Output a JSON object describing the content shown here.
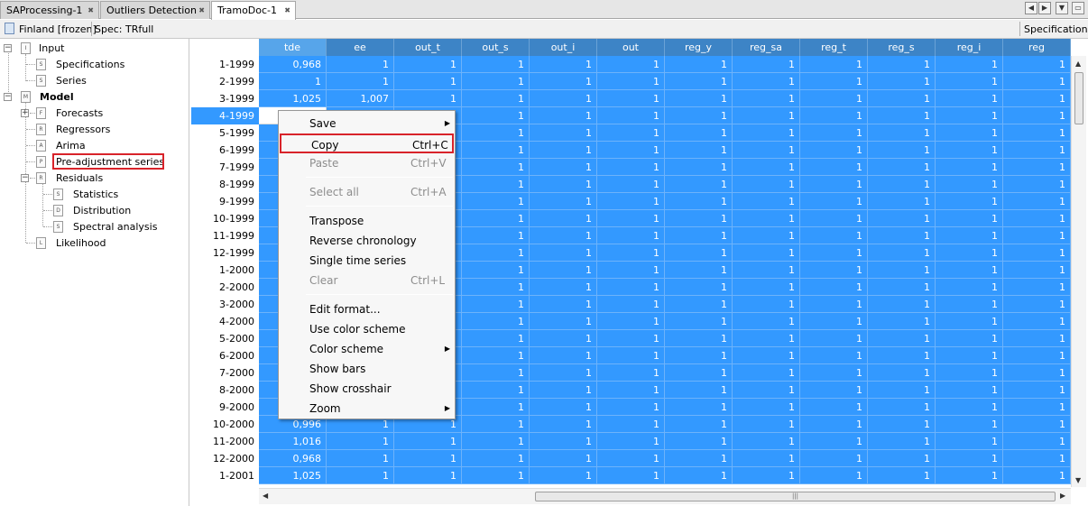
{
  "tabs": [
    {
      "label": "SAProcessing-1",
      "active": false
    },
    {
      "label": "Outliers Detection",
      "active": false
    },
    {
      "label": "TramoDoc-1",
      "active": true
    }
  ],
  "infobar": {
    "document": "Finland [frozen]",
    "spec": "Spec: TRfull",
    "right_label": "Specifications"
  },
  "tree": {
    "input": "Input",
    "specifications": "Specifications",
    "series": "Series",
    "model": "Model",
    "forecasts": "Forecasts",
    "regressors": "Regressors",
    "arima": "Arima",
    "preadjustment": "Pre-adjustment series",
    "residuals": "Residuals",
    "statistics": "Statistics",
    "distribution": "Distribution",
    "spectral": "Spectral analysis",
    "likelihood": "Likelihood"
  },
  "table": {
    "columns": [
      "tde",
      "ee",
      "out_t",
      "out_s",
      "out_i",
      "out",
      "reg_y",
      "reg_sa",
      "reg_t",
      "reg_s",
      "reg_i",
      "reg"
    ],
    "rows": [
      {
        "label": "1-1999",
        "tde": "0,968",
        "ee": "1"
      },
      {
        "label": "2-1999",
        "tde": "1",
        "ee": "1"
      },
      {
        "label": "3-1999",
        "tde": "1,025",
        "ee": "1,007"
      },
      {
        "label": "4-1999",
        "tde": "",
        "ee": ""
      },
      {
        "label": "5-1999",
        "tde": "",
        "ee": ""
      },
      {
        "label": "6-1999",
        "tde": "",
        "ee": ""
      },
      {
        "label": "7-1999",
        "tde": "",
        "ee": ""
      },
      {
        "label": "8-1999",
        "tde": "",
        "ee": ""
      },
      {
        "label": "9-1999",
        "tde": "",
        "ee": ""
      },
      {
        "label": "10-1999",
        "tde": "",
        "ee": ""
      },
      {
        "label": "11-1999",
        "tde": "",
        "ee": ""
      },
      {
        "label": "12-1999",
        "tde": "",
        "ee": ""
      },
      {
        "label": "1-2000",
        "tde": "",
        "ee": ""
      },
      {
        "label": "2-2000",
        "tde": "",
        "ee": ""
      },
      {
        "label": "3-2000",
        "tde": "",
        "ee": ""
      },
      {
        "label": "4-2000",
        "tde": "",
        "ee": ""
      },
      {
        "label": "5-2000",
        "tde": "",
        "ee": ""
      },
      {
        "label": "6-2000",
        "tde": "",
        "ee": ""
      },
      {
        "label": "7-2000",
        "tde": "",
        "ee": ""
      },
      {
        "label": "8-2000",
        "tde": "",
        "ee": ""
      },
      {
        "label": "9-2000",
        "tde": "",
        "ee": ""
      },
      {
        "label": "10-2000",
        "tde": "0,996",
        "ee": "1"
      },
      {
        "label": "11-2000",
        "tde": "1,016",
        "ee": "1"
      },
      {
        "label": "12-2000",
        "tde": "0,968",
        "ee": "1"
      },
      {
        "label": "1-2001",
        "tde": "1,025",
        "ee": "1"
      }
    ],
    "other_value": "1"
  },
  "context_menu": {
    "items": [
      {
        "label": "Save",
        "shortcut": "",
        "submenu": true,
        "disabled": false
      },
      {
        "label": "Copy",
        "shortcut": "Ctrl+C",
        "submenu": false,
        "disabled": false,
        "highlighted": true
      },
      {
        "label": "Paste",
        "shortcut": "Ctrl+V",
        "submenu": false,
        "disabled": true
      },
      {
        "label": "Select all",
        "shortcut": "Ctrl+A",
        "submenu": false,
        "disabled": true
      },
      {
        "label": "Transpose",
        "shortcut": "",
        "submenu": false,
        "disabled": false
      },
      {
        "label": "Reverse chronology",
        "shortcut": "",
        "submenu": false,
        "disabled": false
      },
      {
        "label": "Single time series",
        "shortcut": "",
        "submenu": false,
        "disabled": false
      },
      {
        "label": "Clear",
        "shortcut": "Ctrl+L",
        "submenu": false,
        "disabled": true
      },
      {
        "label": "Edit format...",
        "shortcut": "",
        "submenu": false,
        "disabled": false
      },
      {
        "label": "Use color scheme",
        "shortcut": "",
        "submenu": false,
        "disabled": false
      },
      {
        "label": "Color scheme",
        "shortcut": "",
        "submenu": true,
        "disabled": false
      },
      {
        "label": "Show bars",
        "shortcut": "",
        "submenu": false,
        "disabled": false
      },
      {
        "label": "Show crosshair",
        "shortcut": "",
        "submenu": false,
        "disabled": false
      },
      {
        "label": "Zoom",
        "shortcut": "",
        "submenu": true,
        "disabled": false
      }
    ]
  },
  "colors": {
    "selection": "#3399ff",
    "header": "#3d84c6",
    "highlight_border": "#d8232a"
  }
}
